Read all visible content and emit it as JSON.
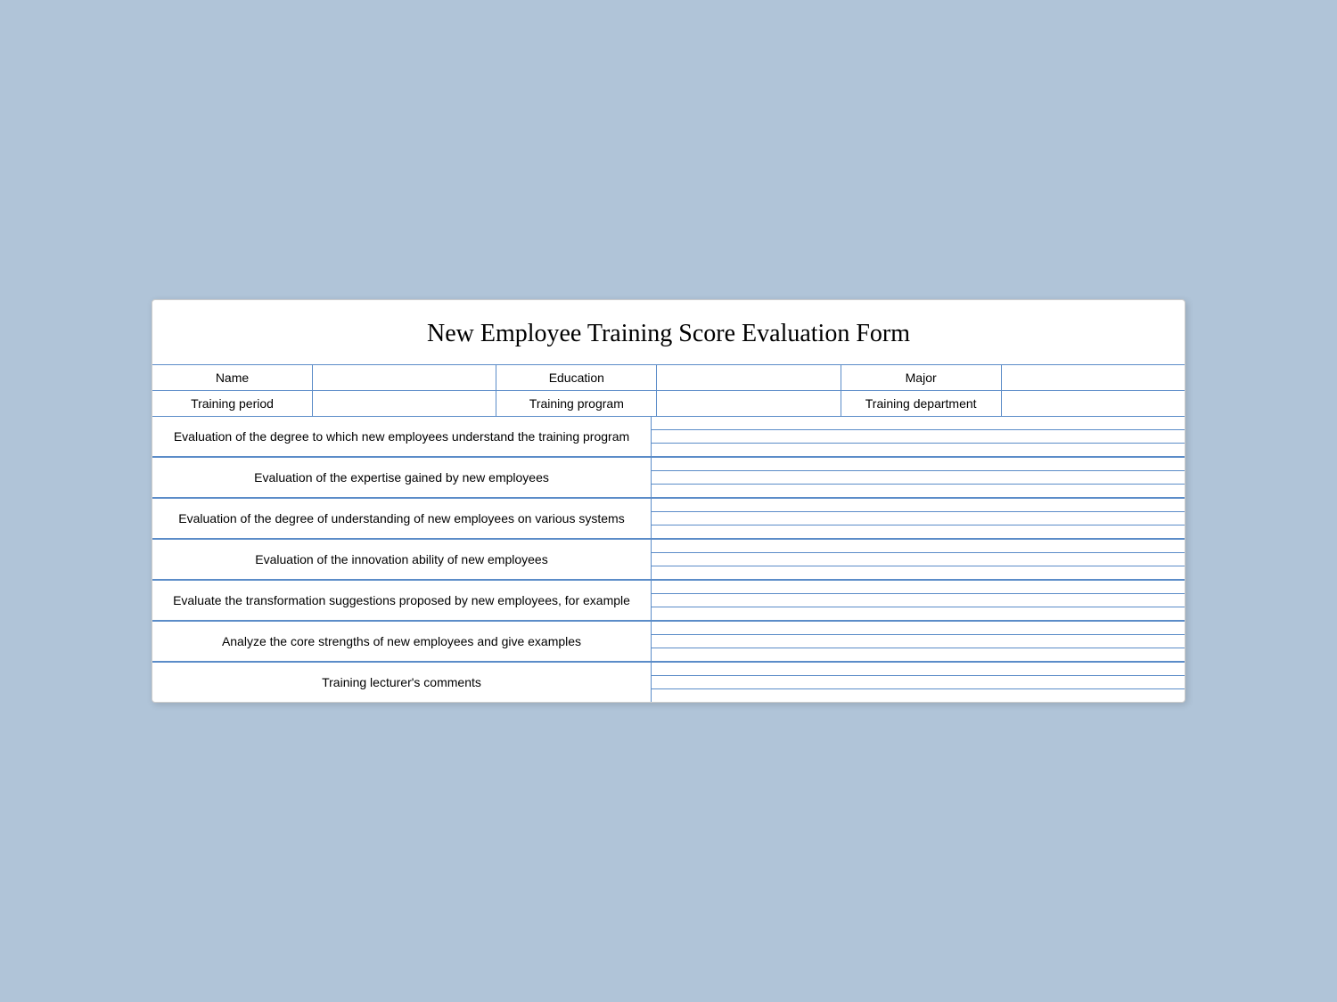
{
  "title": "New Employee Training Score Evaluation Form",
  "header": {
    "row1": {
      "name_label": "Name",
      "name_value": "",
      "education_label": "Education",
      "education_value": "",
      "major_label": "Major",
      "major_value": ""
    },
    "row2": {
      "period_label": "Training period",
      "period_value": "",
      "program_label": "Training program",
      "program_value": "",
      "dept_label": "Training department",
      "dept_value": ""
    }
  },
  "sections": [
    {
      "id": "section1",
      "label": "Evaluation of the degree to which new employees understand the training program",
      "lines": 3
    },
    {
      "id": "section2",
      "label": "Evaluation of the expertise gained by new employees",
      "lines": 3
    },
    {
      "id": "section3",
      "label": "Evaluation of the degree of understanding of new employees on various systems",
      "lines": 3
    },
    {
      "id": "section4",
      "label": "Evaluation of the innovation ability of new employees",
      "lines": 3
    },
    {
      "id": "section5",
      "label": "Evaluate the transformation suggestions proposed by new employees, for example",
      "lines": 3
    },
    {
      "id": "section6",
      "label": "Analyze the core strengths of new employees and give examples",
      "lines": 3
    },
    {
      "id": "section7",
      "label": "Training lecturer's comments",
      "lines": 3
    }
  ]
}
